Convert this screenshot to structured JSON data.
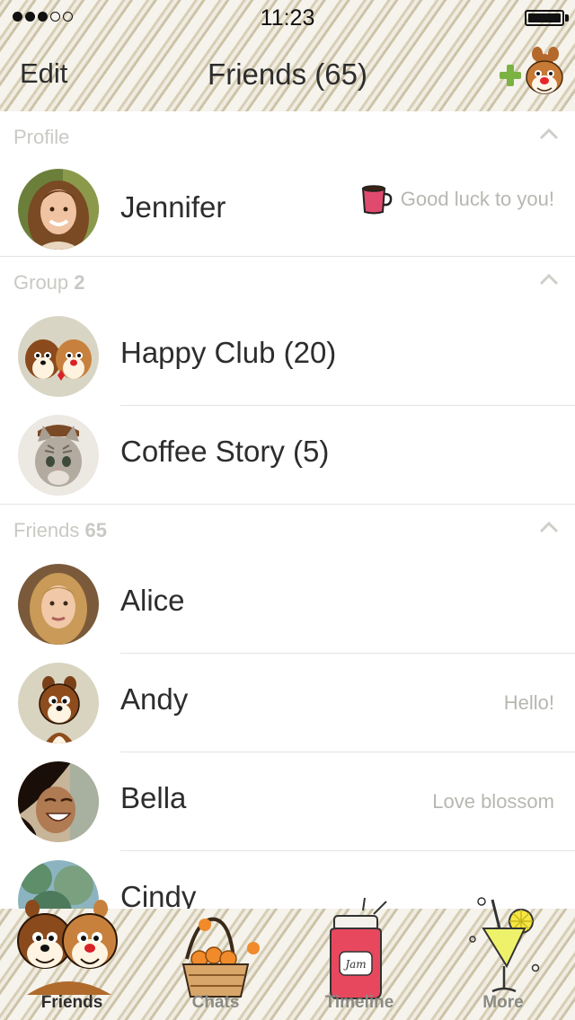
{
  "status_bar": {
    "time": "11:23",
    "signal_bars": 3,
    "signal_total": 5,
    "battery_level": 1.0
  },
  "nav": {
    "edit_label": "Edit",
    "title": "Friends (65)",
    "add_icon": "add-friend-chipmunk-icon"
  },
  "sections": {
    "profile": {
      "label": "Profile",
      "count": ""
    },
    "groups": {
      "label": "Group",
      "count": "2"
    },
    "friends": {
      "label": "Friends",
      "count": "65"
    }
  },
  "profile": {
    "name": "Jennifer",
    "status": "Good luck to you!",
    "status_icon": "coffee-cup-icon"
  },
  "groups": [
    {
      "name": "Happy Club (20)"
    },
    {
      "name": "Coffee Story (5)"
    }
  ],
  "friends": [
    {
      "name": "Alice",
      "status": ""
    },
    {
      "name": "Andy",
      "status": "Hello!"
    },
    {
      "name": "Bella",
      "status": "Love blossom"
    },
    {
      "name": "Cindy",
      "status": ""
    }
  ],
  "tabs": [
    {
      "label": "Friends",
      "icon": "chipmunks-icon",
      "active": true
    },
    {
      "label": "Chats",
      "icon": "basket-icon",
      "active": false
    },
    {
      "label": "Timeline",
      "icon": "jam-jar-icon",
      "active": false
    },
    {
      "label": "More",
      "icon": "lemonade-glass-icon",
      "active": false
    }
  ],
  "colors": {
    "text": "#2d2d2d",
    "muted": "#b7b7b1",
    "section": "#c9c9c4",
    "separator": "#e4e4e0",
    "add_green": "#7ab342"
  }
}
